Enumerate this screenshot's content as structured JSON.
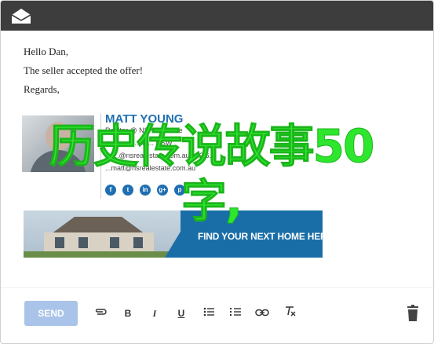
{
  "email": {
    "greeting": "Hello Dan,",
    "line1": "The seller accepted the offer!",
    "closing": "Regards,"
  },
  "signature": {
    "name": "MATT YOUNG",
    "line1": "Realtor @ NSRealestate",
    "line2": "m 3... ... ...ke ... NSW",
    "line3": "... ...@nsrealestate.com.au | 02 6...",
    "line4": "...matt@nsrealestate.com.au",
    "social": [
      "f",
      "t",
      "in",
      "g+",
      "p"
    ]
  },
  "banner": {
    "cta": "FIND YOUR NEXT HOME HERE"
  },
  "overlay_text": "历史传说故事50字,",
  "toolbar": {
    "send_label": "SEND",
    "icons": [
      "paperclip-icon",
      "bold-icon",
      "italic-icon",
      "underline-icon",
      "bulleted-list-icon",
      "numbered-list-icon",
      "link-icon",
      "clear-format-icon"
    ]
  },
  "colors": {
    "titlebar": "#3d3d3d",
    "accent": "#1f6fb2",
    "send": "#a9c4e8",
    "overlay": "#2ee62e"
  }
}
